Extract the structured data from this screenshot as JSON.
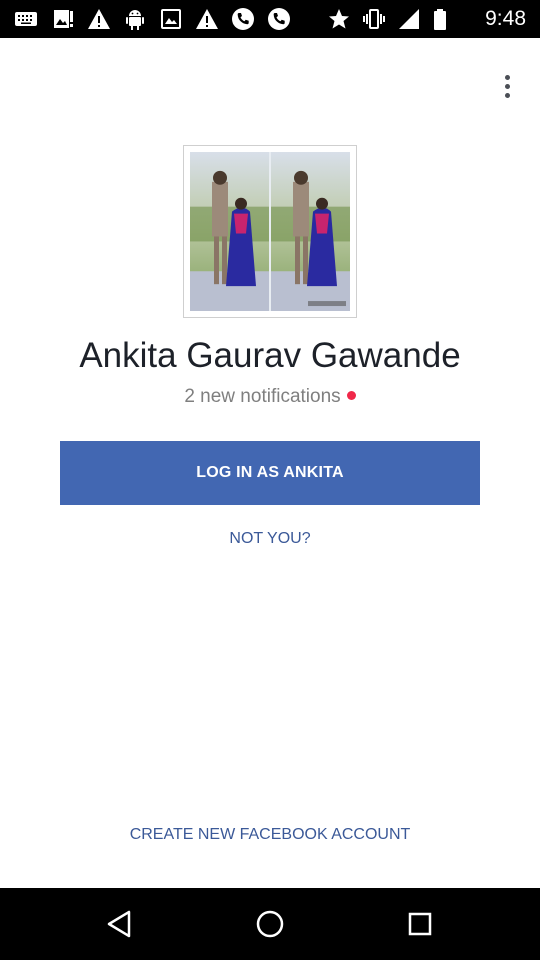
{
  "status_bar": {
    "time": "9:48",
    "icons": [
      "keyboard-icon",
      "photo-alert-icon",
      "warning-icon",
      "android-icon",
      "image-icon",
      "warning-icon",
      "phone-call-icon",
      "phone-call-icon",
      "star-icon",
      "vibrate-icon",
      "signal-icon",
      "battery-icon"
    ]
  },
  "header": {
    "overflow_menu_icon": "more-vertical-icon"
  },
  "profile": {
    "name": "Ankita Gaurav Gawande",
    "notifications": "2 new notifications",
    "notification_dot_color": "#f02849"
  },
  "actions": {
    "login_label": "LOG IN AS ANKITA",
    "not_you_label": "NOT YOU?",
    "create_account_label": "CREATE NEW FACEBOOK ACCOUNT"
  },
  "colors": {
    "brand_blue": "#4267b2",
    "link_blue": "#3b5998"
  },
  "nav_bar": {
    "back_icon": "back-triangle-icon",
    "home_icon": "home-circle-icon",
    "recents_icon": "recents-square-icon"
  }
}
